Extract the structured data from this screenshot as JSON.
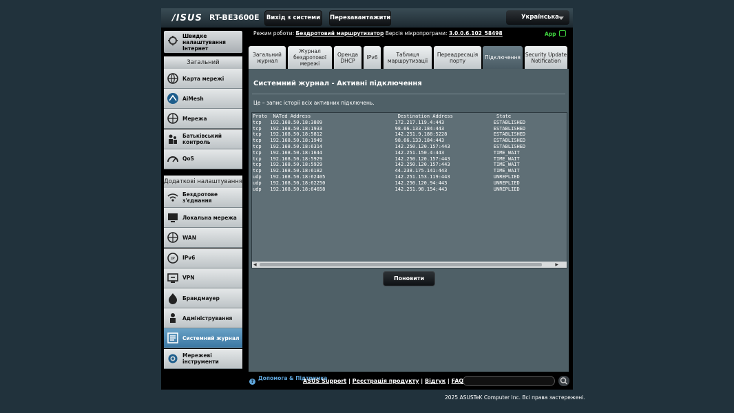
{
  "header": {
    "brand": "/ISUS",
    "model": "RT-BE3600E",
    "logout_label": "Вихід з системи",
    "reboot_label": "Перезавантажити",
    "language": "Українська"
  },
  "status": {
    "mode_label": "Режим роботи:",
    "mode_value": "Бездротовий маршрутизатор",
    "firmware_label": "Версія мікропрограми:",
    "firmware_value": "3.0.0.6.102_58498",
    "app_label": "App"
  },
  "sidebar": {
    "quick_internet": "Швидке налаштування Інтернет",
    "general_header": "Загальний",
    "general_items": [
      {
        "label": "Карта мережі",
        "icon": "network-map-icon"
      },
      {
        "label": "AiMesh",
        "icon": "aimesh-icon"
      },
      {
        "label": "Мережа",
        "icon": "globe-icon"
      },
      {
        "label": "Батьківський контроль",
        "icon": "family-icon"
      },
      {
        "label": "QoS",
        "icon": "qos-gauge-icon"
      }
    ],
    "advanced_header": "Додаткові налаштування",
    "advanced_items": [
      {
        "label": "Бездротове з'єднання",
        "icon": "wifi-icon"
      },
      {
        "label": "Локальна мережа",
        "icon": "lan-icon"
      },
      {
        "label": "WAN",
        "icon": "globe-icon"
      },
      {
        "label": "IPv6",
        "icon": "ipv6-icon"
      },
      {
        "label": "VPN",
        "icon": "vpn-icon"
      },
      {
        "label": "Брандмауер",
        "icon": "firewall-icon"
      },
      {
        "label": "Адміністрування",
        "icon": "admin-icon"
      },
      {
        "label": "Системний журнал",
        "icon": "system-log-icon",
        "active": true
      },
      {
        "label": "Мережеві інструменти",
        "icon": "network-tools-icon"
      }
    ]
  },
  "tabs": [
    {
      "label": "Загальний журнал"
    },
    {
      "label": "Журнал бездротової мережі"
    },
    {
      "label": "Оренда DHCP"
    },
    {
      "label": "IPv6"
    },
    {
      "label": "Таблиця маршрутизації"
    },
    {
      "label": "Переадресація порту"
    },
    {
      "label": "Підключення",
      "active": true
    },
    {
      "label": "Security Update Notification"
    }
  ],
  "main": {
    "title": "Системний журнал - Активні підключення",
    "description": "Це – запис історії всіх активних підключень.",
    "refresh_label": "Поновити"
  },
  "connections": {
    "headers": [
      "Proto",
      "NATed Address",
      "Destination Address",
      "State"
    ],
    "rows": [
      [
        "tcp",
        "192.168.50.18:3809",
        "172.217.119.4:443",
        "ESTABLISHED"
      ],
      [
        "tcp",
        "192.168.50.18:1933",
        "98.66.133.184:443",
        "ESTABLISHED"
      ],
      [
        "tcp",
        "192.168.50.18:5812",
        "142.251.9.188:5228",
        "ESTABLISHED"
      ],
      [
        "tcp",
        "192.168.50.18:1949",
        "98.66.133.184:443",
        "ESTABLISHED"
      ],
      [
        "tcp",
        "192.168.50.18:6314",
        "142.250.120.157:443",
        "ESTABLISHED"
      ],
      [
        "tcp",
        "192.168.50.18:1644",
        "142.251.150.4:443",
        "TIME_WAIT"
      ],
      [
        "tcp",
        "192.168.50.18:5929",
        "142.250.120.157:443",
        "TIME_WAIT"
      ],
      [
        "tcp",
        "192.168.50.18:5929",
        "142.250.120.157:443",
        "TIME_WAIT"
      ],
      [
        "tcp",
        "192.168.50.18:6182",
        "44.238.175.141:443",
        "TIME_WAIT"
      ],
      [
        "udp",
        "192.168.50.18:62405",
        "142.251.153.119:443",
        "UNREPLIED"
      ],
      [
        "udp",
        "192.168.50.18:62250",
        "142.250.120.94:443",
        "UNREPLIED"
      ],
      [
        "udp",
        "192.168.50.18:64658",
        "142.251.98.154:443",
        "UNREPLIED"
      ]
    ]
  },
  "footer": {
    "help_label": "Допомога & Підтримка",
    "links": [
      "ASUS Support",
      "Реєстрація продукту",
      "Відгук",
      "FAQ"
    ],
    "search_value": "",
    "copyright": "2025 ASUSTeK Computer Inc. Всі права застережені."
  },
  "colors": {
    "background": "#21323c",
    "panel": "#4f6067",
    "active_menu": "#4a86b2",
    "app_green": "#3fd33f",
    "help_link": "#5fa6dc"
  }
}
